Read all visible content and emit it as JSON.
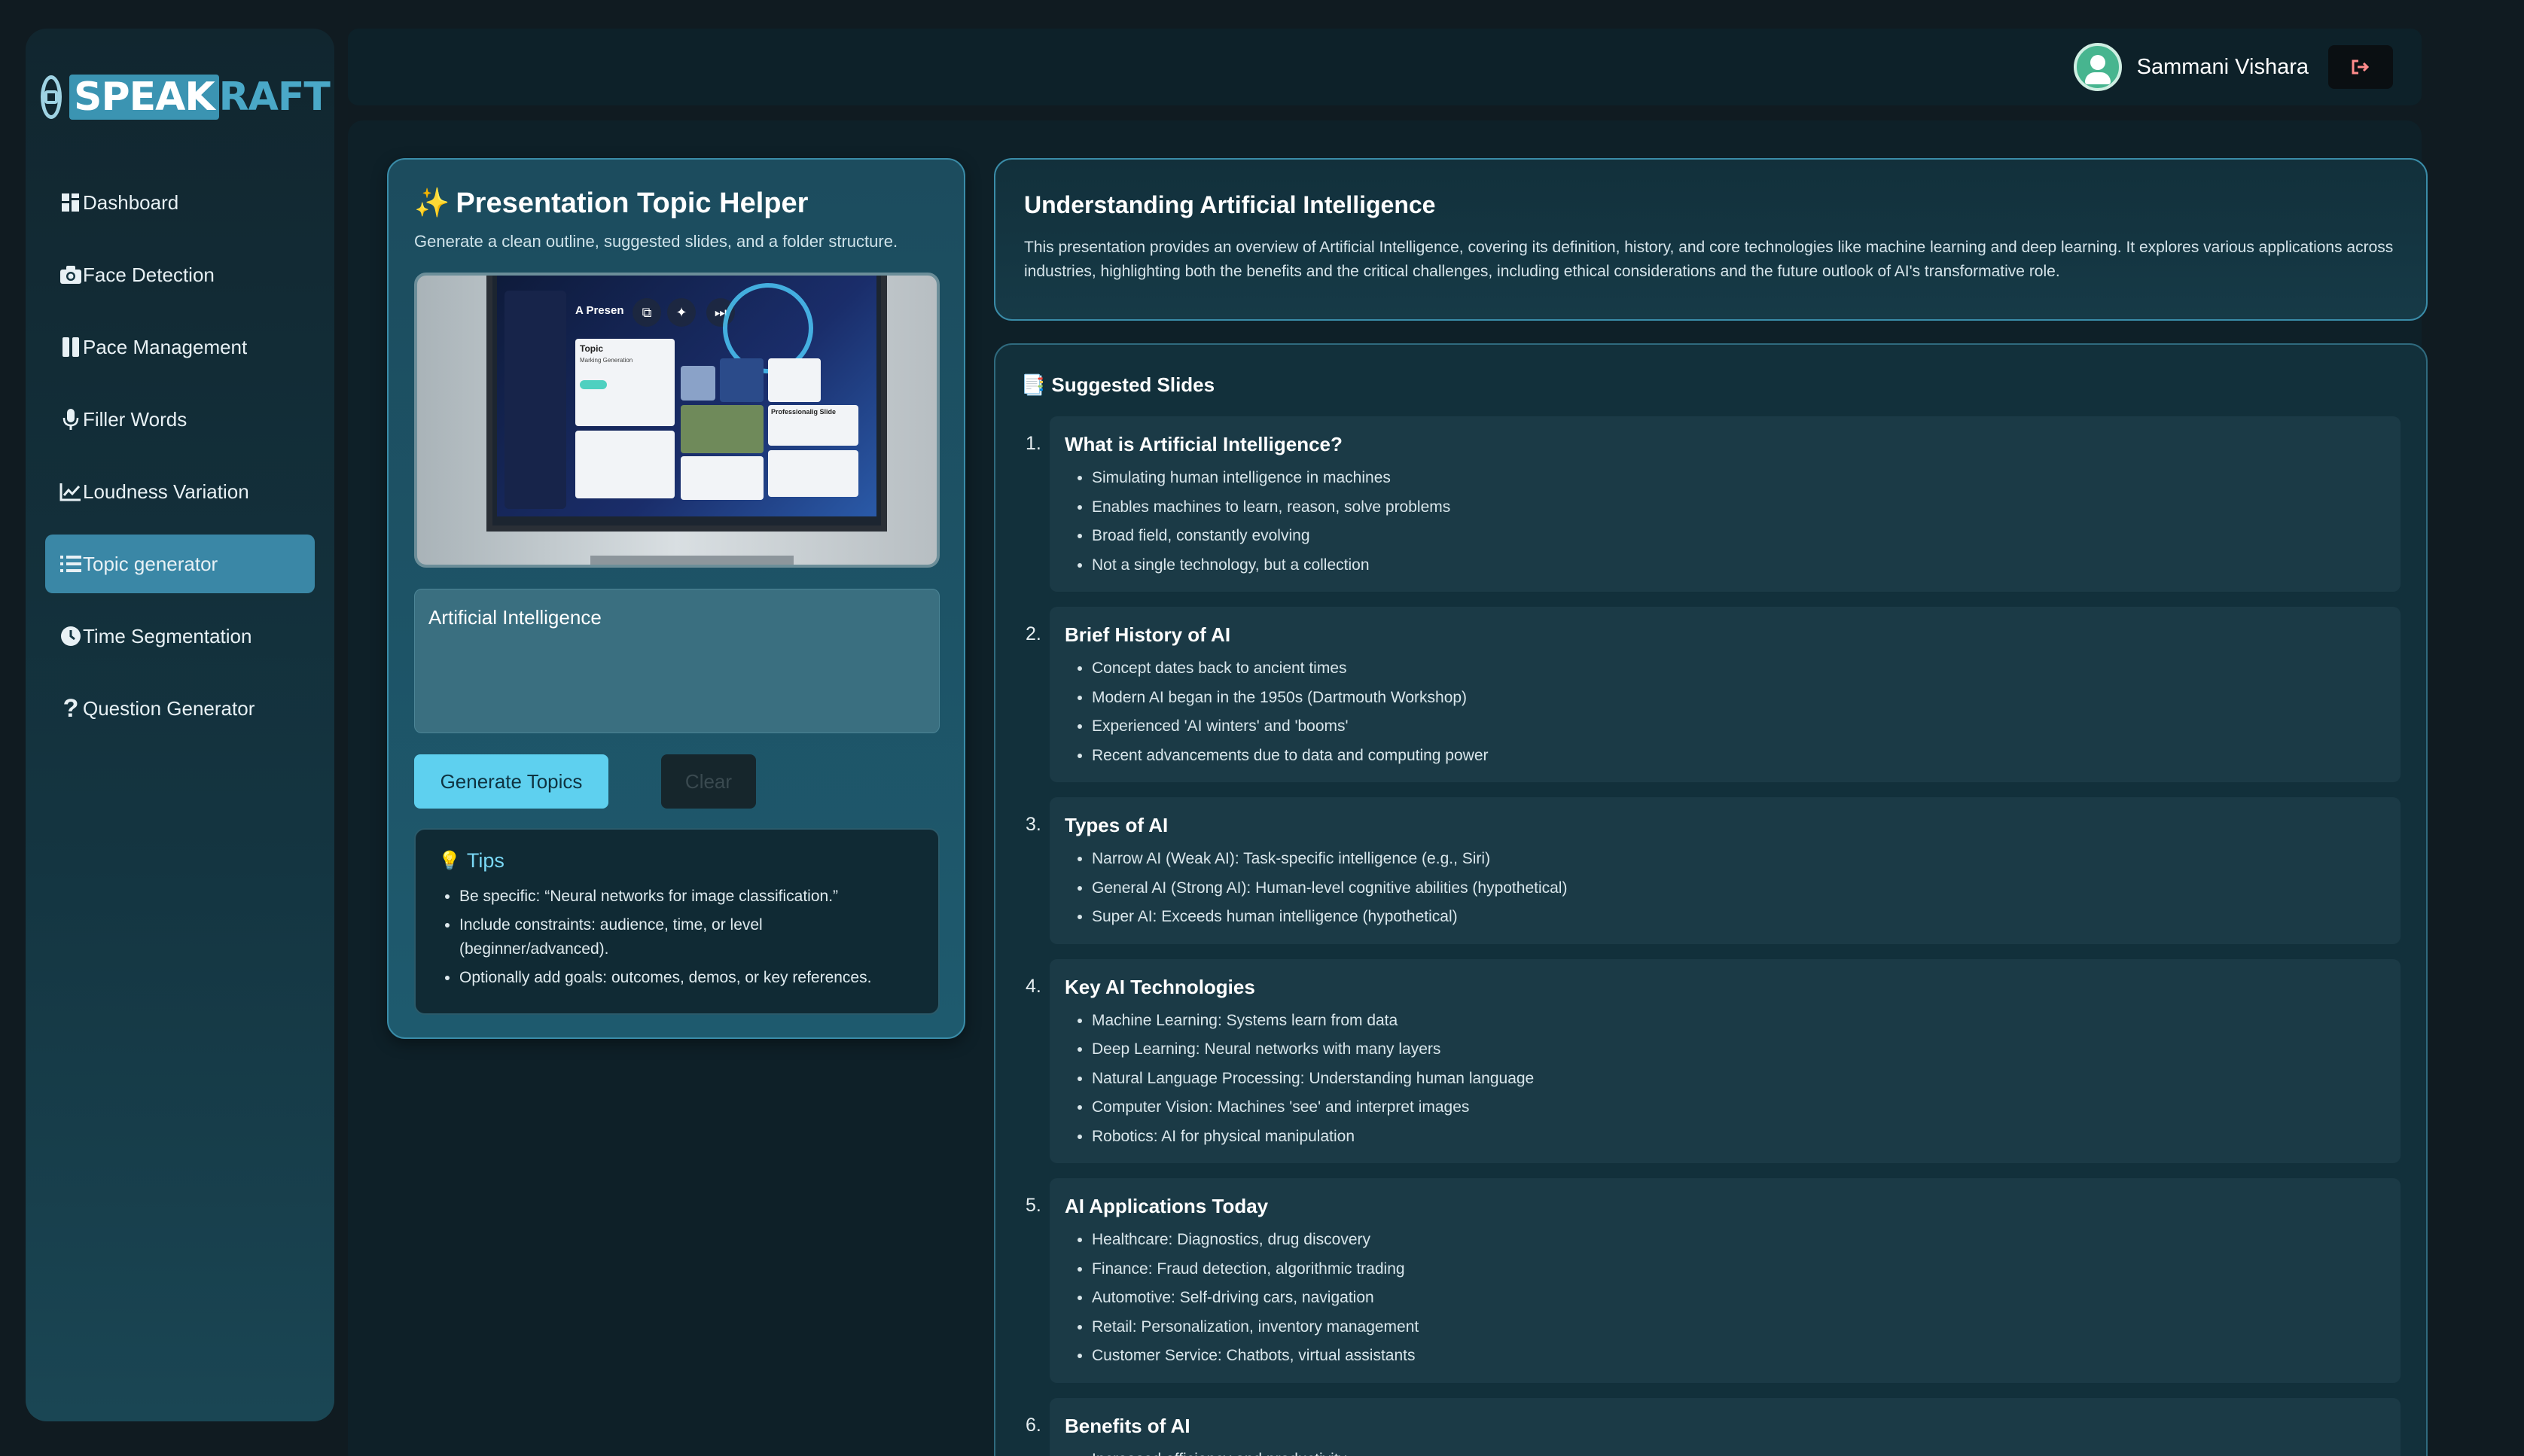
{
  "app": {
    "logo_text": "SPEAKRAFT"
  },
  "sidebar": {
    "items": [
      {
        "label": "Dashboard",
        "icon": "grid-icon"
      },
      {
        "label": "Face Detection",
        "icon": "camera-icon"
      },
      {
        "label": "Pace Management",
        "icon": "pause-icon"
      },
      {
        "label": "Filler Words",
        "icon": "microphone-icon"
      },
      {
        "label": "Loudness Variation",
        "icon": "line-chart-icon"
      },
      {
        "label": "Topic generator",
        "icon": "list-icon",
        "active": true
      },
      {
        "label": "Time Segmentation",
        "icon": "clock-icon"
      },
      {
        "label": "Question Generator",
        "icon": "question-icon"
      }
    ]
  },
  "header": {
    "user_name": "Sammani Vishara",
    "logout_icon": "logout-icon"
  },
  "helper": {
    "title": "Presentation Topic Helper",
    "subtitle": "Generate a clean outline, suggested slides, and a folder structure.",
    "preview": {
      "title": "A Presen",
      "card_topic": "Topic",
      "card_marking": "Marking Generation",
      "card_slide": "Professionalig Slide"
    },
    "input_value": "Artificial Intelligence",
    "generate_label": "Generate Topics",
    "clear_label": "Clear",
    "tips": {
      "title": "Tips",
      "items": [
        "Be specific: “Neural networks for image classification.”",
        "Include constraints: audience, time, or level (beginner/advanced).",
        "Optionally add goals: outcomes, demos, or key references."
      ]
    }
  },
  "overview": {
    "title": "Understanding Artificial Intelligence",
    "description": "This presentation provides an overview of Artificial Intelligence, covering its definition, history, and core technologies like machine learning and deep learning. It explores various applications across industries, highlighting both the benefits and the critical challenges, including ethical considerations and the future outlook of AI's transformative role."
  },
  "slides": {
    "heading": "Suggested Slides",
    "items": [
      {
        "num": "1.",
        "title": "What is Artificial Intelligence?",
        "bullets": [
          "Simulating human intelligence in machines",
          "Enables machines to learn, reason, solve problems",
          "Broad field, constantly evolving",
          "Not a single technology, but a collection"
        ]
      },
      {
        "num": "2.",
        "title": "Brief History of AI",
        "bullets": [
          "Concept dates back to ancient times",
          "Modern AI began in the 1950s (Dartmouth Workshop)",
          "Experienced 'AI winters' and 'booms'",
          "Recent advancements due to data and computing power"
        ]
      },
      {
        "num": "3.",
        "title": "Types of AI",
        "bullets": [
          "Narrow AI (Weak AI): Task-specific intelligence (e.g., Siri)",
          "General AI (Strong AI): Human-level cognitive abilities (hypothetical)",
          "Super AI: Exceeds human intelligence (hypothetical)"
        ]
      },
      {
        "num": "4.",
        "title": "Key AI Technologies",
        "bullets": [
          "Machine Learning: Systems learn from data",
          "Deep Learning: Neural networks with many layers",
          "Natural Language Processing: Understanding human language",
          "Computer Vision: Machines 'see' and interpret images",
          "Robotics: AI for physical manipulation"
        ]
      },
      {
        "num": "5.",
        "title": "AI Applications Today",
        "bullets": [
          "Healthcare: Diagnostics, drug discovery",
          "Finance: Fraud detection, algorithmic trading",
          "Automotive: Self-driving cars, navigation",
          "Retail: Personalization, inventory management",
          "Customer Service: Chatbots, virtual assistants"
        ]
      },
      {
        "num": "6.",
        "title": "Benefits of AI",
        "bullets": [
          "Increased efficiency and productivity"
        ]
      }
    ]
  }
}
